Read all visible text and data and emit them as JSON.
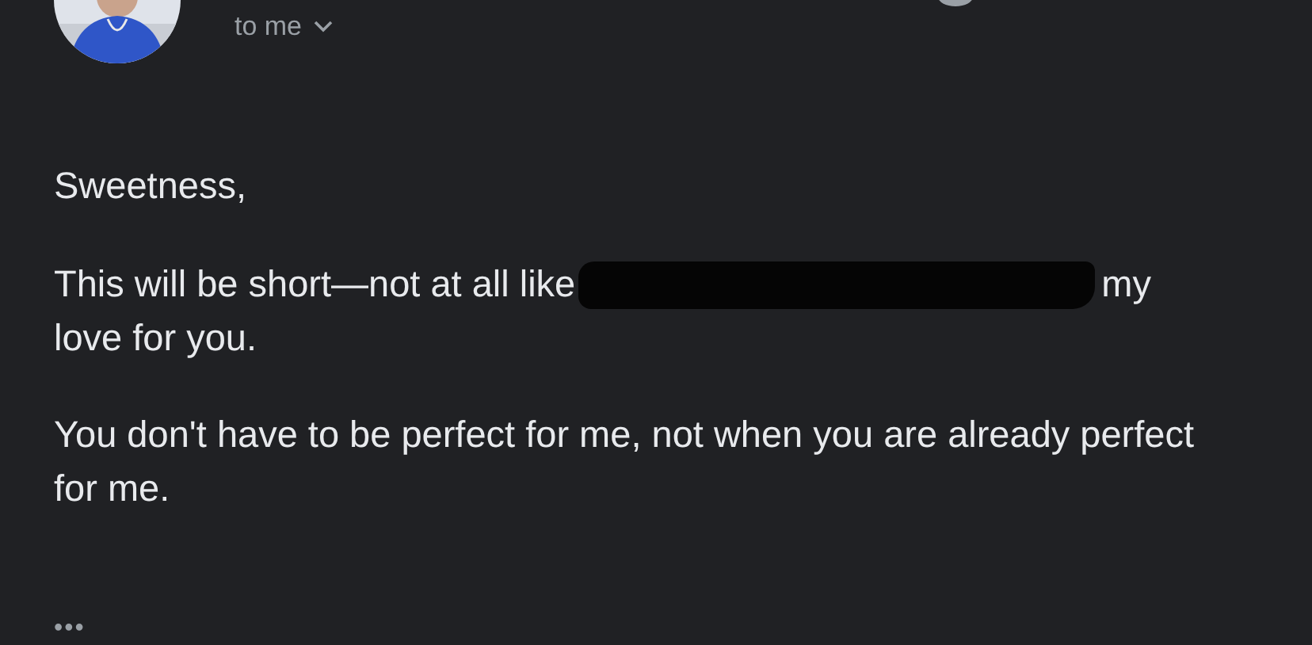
{
  "header": {
    "recipient": "to me"
  },
  "body": {
    "greeting": "Sweetness,",
    "paragraphs": [
      {
        "kind": "redacted",
        "before": "This will be short—not at all like",
        "after": "my",
        "continued": "love for you."
      },
      {
        "kind": "plain",
        "text": "You don't have to be perfect for me, not when you are already perfect for me."
      }
    ],
    "more": "•••"
  }
}
